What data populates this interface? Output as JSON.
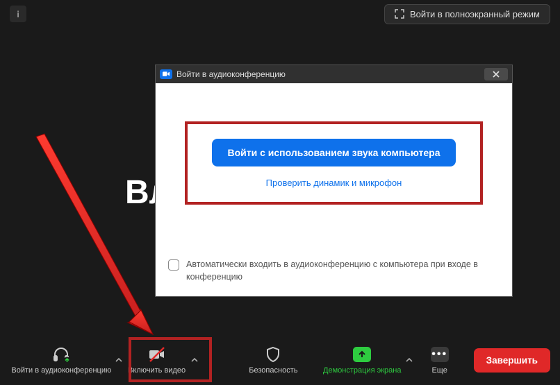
{
  "topbar": {
    "info_label": "i",
    "fullscreen_label": "Войти в полноэкранный режим"
  },
  "main": {
    "background_text": "Вл"
  },
  "dialog": {
    "title": "Войти в аудиоконференцию",
    "primary_button": "Войти с использованием звука компьютера",
    "test_link": "Проверить динамик и микрофон",
    "auto_join_label": "Автоматически входить в аудиоконференцию с компьютера при входе в конференцию"
  },
  "toolbar": {
    "audio": "Войти в аудиоконференцию",
    "video": "Включить видео",
    "security": "Безопасность",
    "screenshare": "Демонстрация экрана",
    "more": "Еще",
    "end": "Завершить"
  }
}
